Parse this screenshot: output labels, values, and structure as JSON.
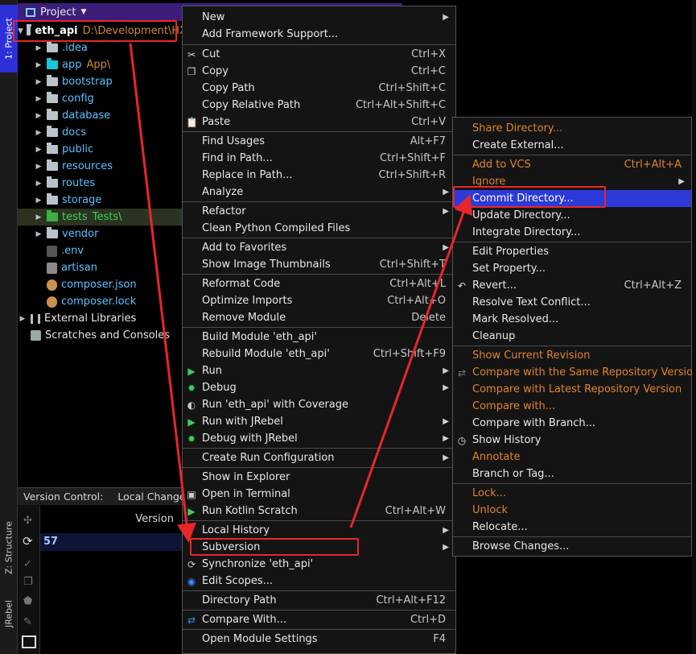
{
  "sidebar": {
    "project_tab": "1: Project",
    "structure_tab": "Z: Structure",
    "jrebel_tab": "JRebel"
  },
  "project": {
    "title": "Project",
    "root": {
      "name": "eth_api",
      "path": "D:\\Development\\HX"
    },
    "items": [
      {
        "name": ".idea"
      },
      {
        "name": "app",
        "sub": "App\\"
      },
      {
        "name": "bootstrap"
      },
      {
        "name": "config"
      },
      {
        "name": "database"
      },
      {
        "name": "docs"
      },
      {
        "name": "public"
      },
      {
        "name": "resources"
      },
      {
        "name": "routes"
      },
      {
        "name": "storage"
      },
      {
        "name": "tests",
        "sub": "Tests\\"
      },
      {
        "name": "vendor"
      },
      {
        "name": ".env"
      },
      {
        "name": "artisan"
      },
      {
        "name": "composer.json"
      },
      {
        "name": "composer.lock"
      }
    ],
    "external_libraries": "External Libraries",
    "scratches": "Scratches and Consoles"
  },
  "version_control": {
    "label": "Version Control:",
    "tab": "Local Changes",
    "column": "Version",
    "row_value": "57"
  },
  "menu": {
    "new": "New",
    "add_framework": "Add Framework Support...",
    "cut": "Cut",
    "cut_sc": "Ctrl+X",
    "copy": "Copy",
    "copy_sc": "Ctrl+C",
    "copy_path": "Copy Path",
    "copy_path_sc": "Ctrl+Shift+C",
    "copy_rel": "Copy Relative Path",
    "copy_rel_sc": "Ctrl+Alt+Shift+C",
    "paste": "Paste",
    "paste_sc": "Ctrl+V",
    "find_usages": "Find Usages",
    "find_usages_sc": "Alt+F7",
    "find_in_path": "Find in Path...",
    "find_in_path_sc": "Ctrl+Shift+F",
    "replace_in_path": "Replace in Path...",
    "replace_in_path_sc": "Ctrl+Shift+R",
    "analyze": "Analyze",
    "refactor": "Refactor",
    "clean_python": "Clean Python Compiled Files",
    "add_favorites": "Add to Favorites",
    "show_thumbs": "Show Image Thumbnails",
    "show_thumbs_sc": "Ctrl+Shift+T",
    "reformat": "Reformat Code",
    "reformat_sc": "Ctrl+Alt+L",
    "optimize": "Optimize Imports",
    "optimize_sc": "Ctrl+Alt+O",
    "remove_module": "Remove Module",
    "remove_module_sc": "Delete",
    "build_module": "Build Module 'eth_api'",
    "rebuild_module": "Rebuild Module 'eth_api'",
    "rebuild_module_sc": "Ctrl+Shift+F9",
    "run": "Run",
    "debug": "Debug",
    "run_coverage": "Run 'eth_api' with Coverage",
    "run_jrebel": "Run with JRebel",
    "debug_jrebel": "Debug with JRebel",
    "create_run": "Create Run Configuration",
    "show_explorer": "Show in Explorer",
    "open_terminal": "Open in Terminal",
    "run_kotlin": "Run Kotlin Scratch",
    "run_kotlin_sc": "Ctrl+Alt+W",
    "local_history": "Local History",
    "subversion": "Subversion",
    "synchronize": "Synchronize 'eth_api'",
    "edit_scopes": "Edit Scopes...",
    "directory_path": "Directory Path",
    "directory_path_sc": "Ctrl+Alt+F12",
    "compare_with": "Compare With...",
    "compare_with_sc": "Ctrl+D",
    "open_module_settings": "Open Module Settings",
    "open_module_settings_sc": "F4"
  },
  "submenu": {
    "share": "Share Directory...",
    "create_external": "Create External...",
    "add_vcs": "Add to VCS",
    "add_vcs_sc": "Ctrl+Alt+A",
    "ignore": "Ignore",
    "commit": "Commit Directory...",
    "update": "Update Directory...",
    "integrate": "Integrate Directory...",
    "edit_props": "Edit Properties",
    "set_prop": "Set Property...",
    "revert": "Revert...",
    "revert_sc": "Ctrl+Alt+Z",
    "resolve": "Resolve Text Conflict...",
    "mark_resolved": "Mark Resolved...",
    "cleanup": "Cleanup",
    "show_current": "Show Current Revision",
    "compare_same": "Compare with the Same Repository Version",
    "compare_latest": "Compare with Latest Repository Version",
    "compare_with": "Compare with...",
    "compare_branch": "Compare with Branch...",
    "show_history": "Show History",
    "annotate": "Annotate",
    "branch_tag": "Branch or Tag...",
    "lock": "Lock...",
    "unlock": "Unlock",
    "relocate": "Relocate...",
    "browse_changes": "Browse Changes..."
  },
  "colors": {
    "highlight_box": "#e8262a",
    "selection": "#2d3ad8",
    "vcs_orange": "#e0832b"
  }
}
